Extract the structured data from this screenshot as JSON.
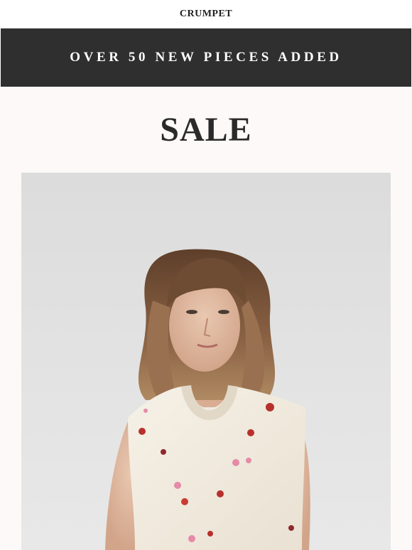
{
  "header": {
    "brand": "CRUMPET"
  },
  "promo_banner": {
    "text": "OVER 50 NEW PIECES ADDED"
  },
  "main": {
    "title": "SALE"
  },
  "hero_image": {
    "alt": "Model wearing a cream knit vest with red and pink pom-pom bobbles",
    "colors": {
      "background": "#e2e2e2",
      "hair": "#8a6244",
      "knit": "#f3ece0",
      "bobble_red": "#b8302c",
      "bobble_pink": "#e58aa8"
    }
  }
}
